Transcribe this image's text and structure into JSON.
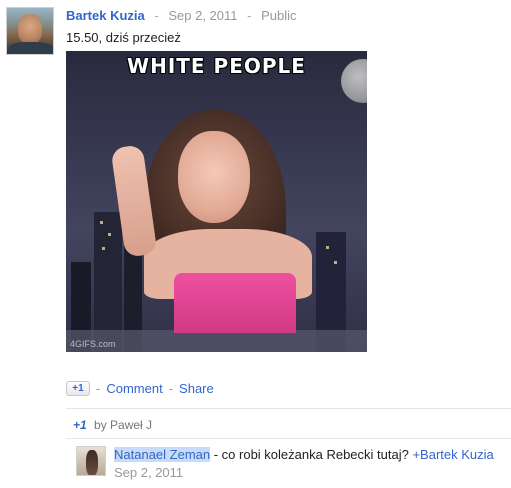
{
  "post": {
    "author": "Bartek Kuzia",
    "separator": "-",
    "date": "Sep 2, 2011",
    "visibility": "Public",
    "text": "15.50, dziś przecież"
  },
  "gif": {
    "caption": "WHITE PEOPLE",
    "watermark": "4GIFS.com"
  },
  "actions": {
    "plus_one_label": "+1",
    "separator": "-",
    "comment_label": "Comment",
    "share_label": "Share"
  },
  "plus_ones": {
    "badge": "+1",
    "text": "by Paweł J"
  },
  "comment": {
    "author": "Natanael Zeman",
    "text": " - co robi koleżanka Rebecki tutaj? ",
    "mention": "+Bartek Kuzia",
    "date": "Sep 2, 2011"
  },
  "colors": {
    "link": "#3366cc",
    "meta": "#999999",
    "highlight": "#c9dcf7",
    "top_pink": "#ef4fa0"
  }
}
